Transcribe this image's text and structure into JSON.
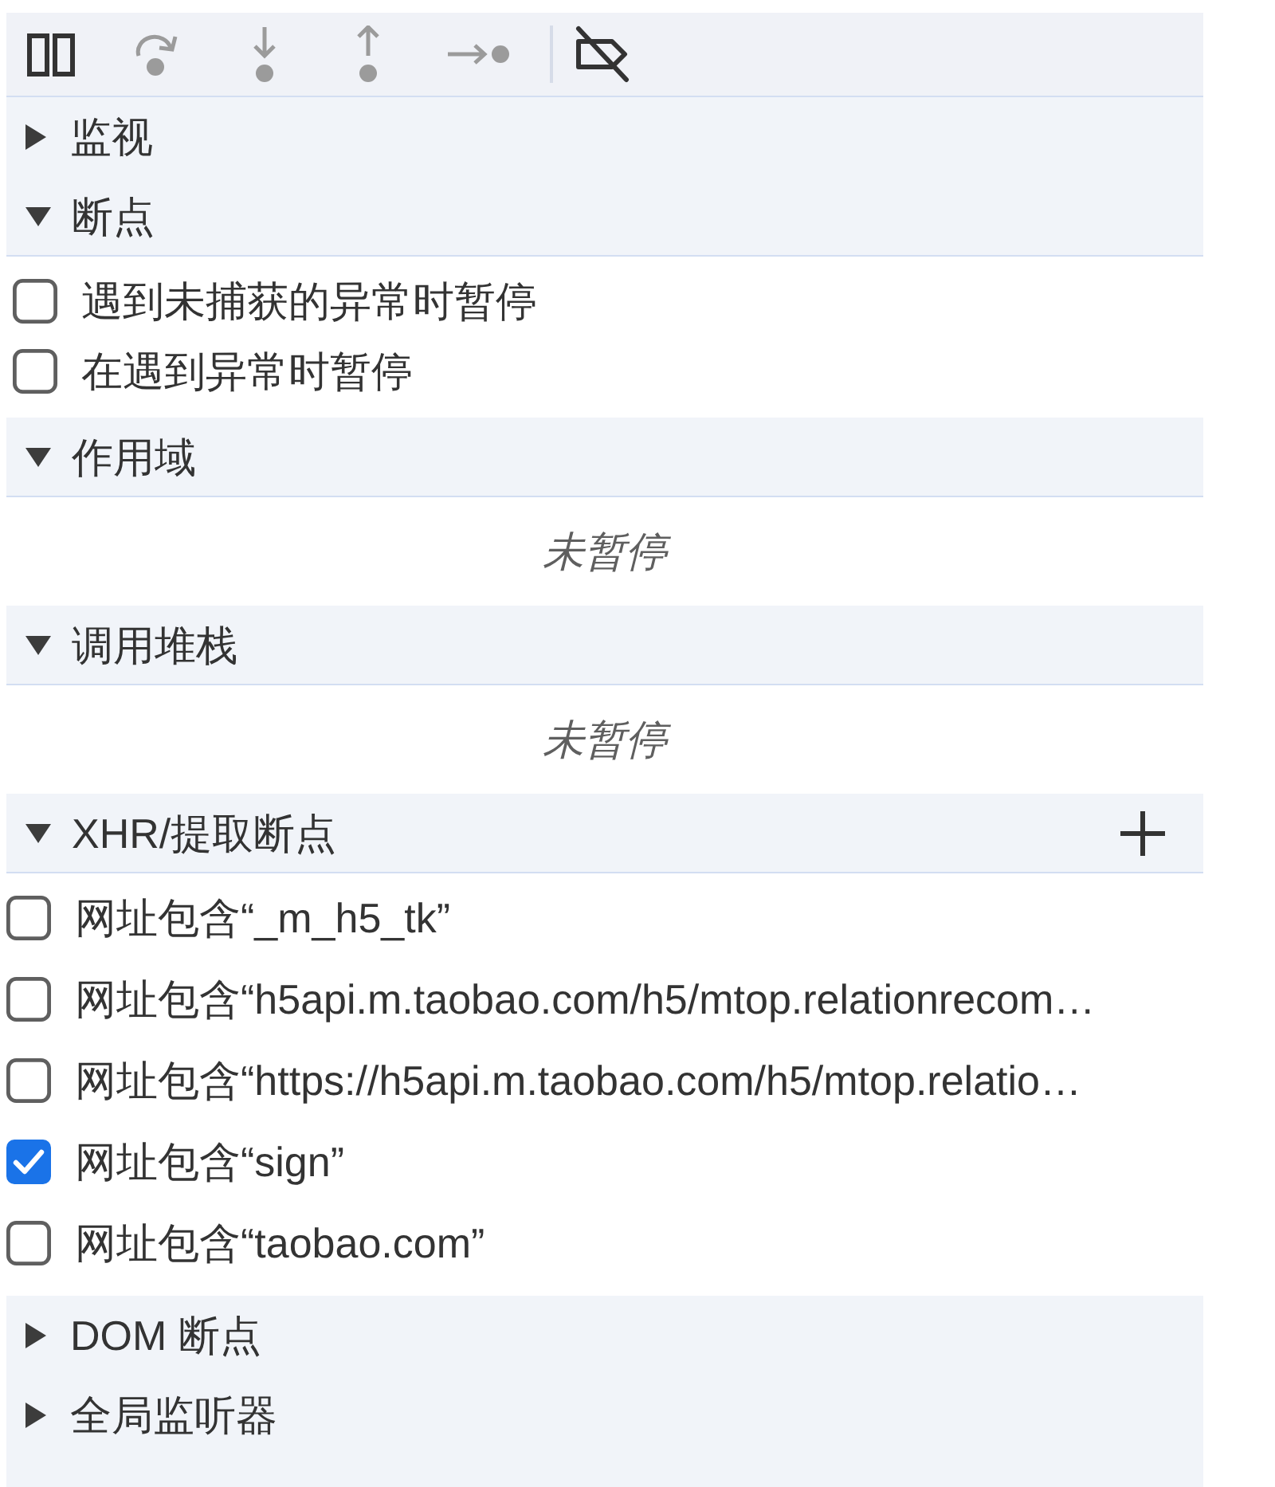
{
  "toolbar": [
    {
      "kind": "pause",
      "disabled": false
    },
    {
      "kind": "step_over",
      "disabled": true
    },
    {
      "kind": "step_into",
      "disabled": true
    },
    {
      "kind": "step_out",
      "disabled": true
    },
    {
      "kind": "step",
      "disabled": true
    },
    {
      "kind": "separator"
    },
    {
      "kind": "deactivate_breakpoints",
      "disabled": false
    }
  ],
  "sections": [
    {
      "title": "监视",
      "expanded": false
    },
    {
      "title": "断点",
      "expanded": true,
      "kind": "checkboxes",
      "items": [
        {
          "label": "遇到未捕获的异常时暂停",
          "checked": false
        },
        {
          "label": "在遇到异常时暂停",
          "checked": false
        }
      ]
    },
    {
      "title": "作用域",
      "expanded": true,
      "kind": "message",
      "message": "未暂停"
    },
    {
      "title": "调用堆栈",
      "expanded": true,
      "kind": "message",
      "message": "未暂停"
    },
    {
      "title": "XHR/提取断点",
      "expanded": true,
      "add_button": true,
      "kind": "checkboxes",
      "items": [
        {
          "label": "网址包含“_m_h5_tk”",
          "checked": false
        },
        {
          "label": "网址包含“h5api.m.taobao.com/h5/mtop.relationrecom…",
          "checked": false
        },
        {
          "label": "网址包含“https://h5api.m.taobao.com/h5/mtop.relatio…",
          "checked": false
        },
        {
          "label": "网址包含“sign”",
          "checked": true
        },
        {
          "label": "网址包含“taobao.com”",
          "checked": false
        }
      ]
    },
    {
      "title": "DOM 断点",
      "expanded": false
    },
    {
      "title": "全局监听器",
      "expanded": false
    }
  ]
}
